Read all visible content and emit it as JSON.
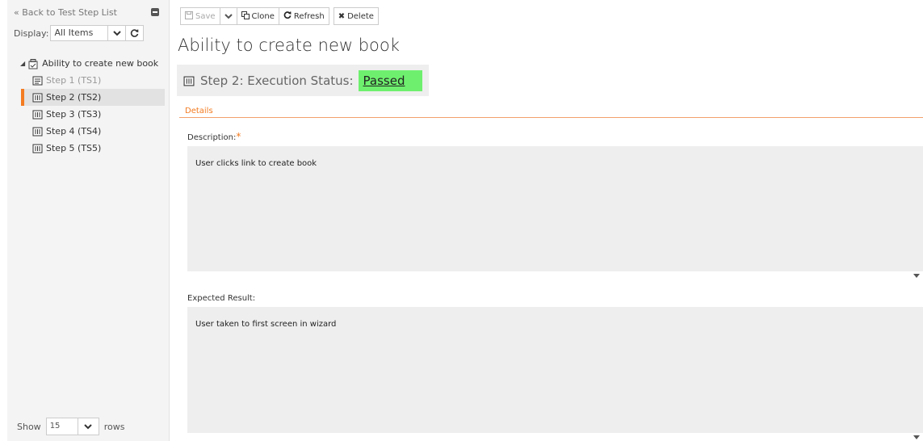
{
  "sidebar": {
    "back_label": "« Back to Test Step List",
    "display_label": "Display:",
    "display_value": "All Items",
    "tree_root": "Ability to create new book",
    "items": [
      {
        "label": "Step 1 (TS1)",
        "state": "muted"
      },
      {
        "label": "Step 2 (TS2)",
        "state": "selected"
      },
      {
        "label": "Step 3 (TS3)",
        "state": "normal"
      },
      {
        "label": "Step 4 (TS4)",
        "state": "normal"
      },
      {
        "label": "Step 5 (TS5)",
        "state": "normal"
      }
    ],
    "show_label": "Show",
    "show_value": "15",
    "rows_label": "rows"
  },
  "toolbar": {
    "save_label": "Save",
    "clone_label": "Clone",
    "refresh_label": "Refresh",
    "delete_label": "Delete"
  },
  "main": {
    "title": "Ability to create new book",
    "status_prefix": "Step 2: Execution Status:",
    "status_value": "Passed",
    "details_tab": "Details",
    "description_label": "Description:",
    "description_required": "*",
    "description_value": "User clicks link to create book",
    "expected_label": "Expected Result:",
    "expected_value": "User taken to first screen in wizard"
  },
  "colors": {
    "accent": "#f37b21",
    "passed": "#6ef06e",
    "panel": "#eeeeee"
  }
}
